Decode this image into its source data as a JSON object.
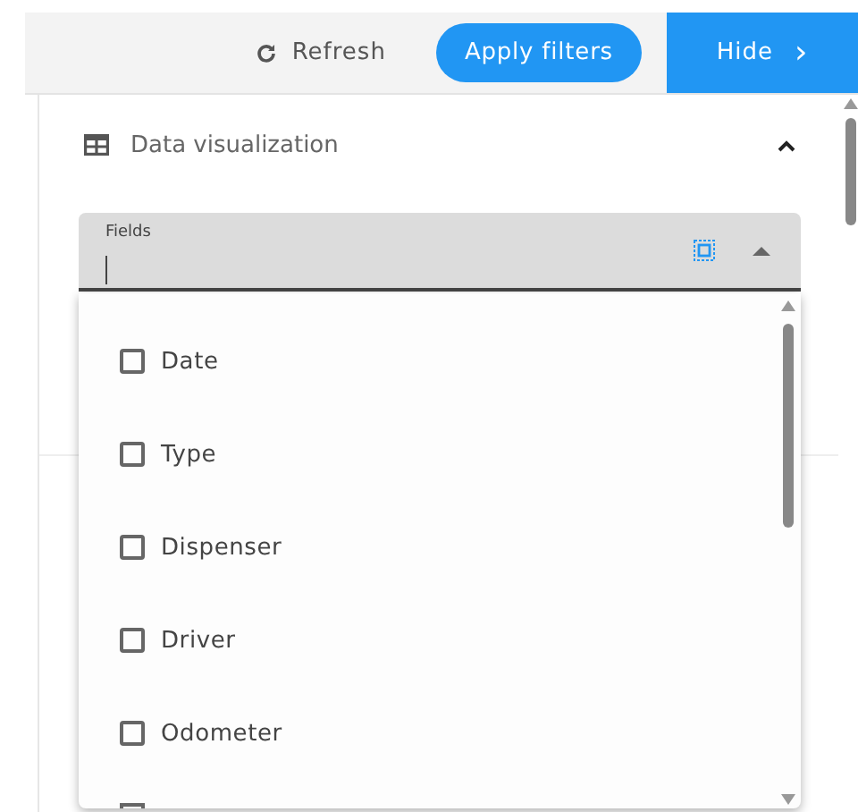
{
  "toolbar": {
    "refresh": "Refresh",
    "apply": "Apply filters",
    "hide": "Hide",
    "hide_icon": "›"
  },
  "section": {
    "title": "Data visualization",
    "expanded": true
  },
  "fields": {
    "label": "Fields",
    "open": true,
    "options": [
      {
        "label": "Date",
        "checked": false
      },
      {
        "label": "Type",
        "checked": false
      },
      {
        "label": "Dispenser",
        "checked": false
      },
      {
        "label": "Driver",
        "checked": false
      },
      {
        "label": "Odometer",
        "checked": false
      }
    ]
  }
}
